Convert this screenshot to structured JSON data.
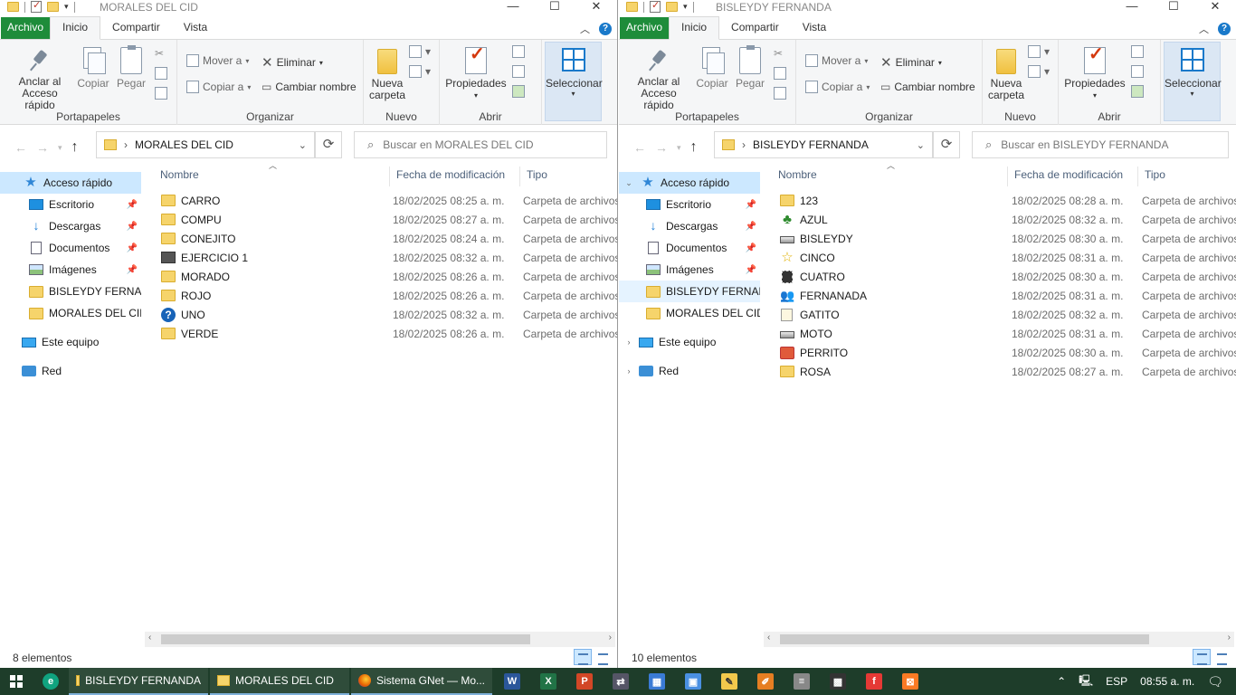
{
  "ribbon_labels": {
    "tab_file": "Archivo",
    "tab_home": "Inicio",
    "tab_share": "Compartir",
    "tab_view": "Vista",
    "pin_quick": "Anclar al",
    "pin_quick2": "Acceso rápido",
    "copy": "Copiar",
    "paste": "Pegar",
    "group_clipboard": "Portapapeles",
    "move_to": "Mover a",
    "copy_to": "Copiar a",
    "delete": "Eliminar",
    "rename": "Cambiar nombre",
    "group_organize": "Organizar",
    "new_folder": "Nueva",
    "new_folder2": "carpeta",
    "group_new": "Nuevo",
    "properties": "Propiedades",
    "group_open": "Abrir",
    "select": "Seleccionar"
  },
  "columns": {
    "name": "Nombre",
    "date": "Fecha de modificación",
    "type": "Tipo"
  },
  "nav": {
    "quick_access": "Acceso rápido",
    "desktop": "Escritorio",
    "downloads": "Descargas",
    "documents": "Documentos",
    "images": "Imágenes",
    "bisleydy": "BISLEYDY FERNANDA",
    "morales": "MORALES DEL CID",
    "this_pc": "Este equipo",
    "network": "Red"
  },
  "left_window": {
    "title": "MORALES DEL CID",
    "address": "MORALES DEL CID",
    "search_placeholder": "Buscar en MORALES DEL CID",
    "status": "8 elementos",
    "files": [
      {
        "name": "CARRO",
        "date": "18/02/2025 08:25 a. m.",
        "type": "Carpeta de archivos",
        "icon": "folder-icon"
      },
      {
        "name": "COMPU",
        "date": "18/02/2025 08:27 a. m.",
        "type": "Carpeta de archivos",
        "icon": "folder-icon"
      },
      {
        "name": "CONEJITO",
        "date": "18/02/2025 08:24 a. m.",
        "type": "Carpeta de archivos",
        "icon": "folder-icon"
      },
      {
        "name": "EJERCICIO 1",
        "date": "18/02/2025 08:32 a. m.",
        "type": "Carpeta de archivos",
        "icon": "program-icon"
      },
      {
        "name": "MORADO",
        "date": "18/02/2025 08:26 a. m.",
        "type": "Carpeta de archivos",
        "icon": "folder-icon"
      },
      {
        "name": "ROJO",
        "date": "18/02/2025 08:26 a. m.",
        "type": "Carpeta de archivos",
        "icon": "folder-icon"
      },
      {
        "name": "UNO",
        "date": "18/02/2025 08:32 a. m.",
        "type": "Carpeta de archivos",
        "icon": "help-icon"
      },
      {
        "name": "VERDE",
        "date": "18/02/2025 08:26 a. m.",
        "type": "Carpeta de archivos",
        "icon": "folder-icon"
      }
    ]
  },
  "right_window": {
    "title": "BISLEYDY FERNANDA",
    "address": "BISLEYDY FERNANDA",
    "search_placeholder": "Buscar en BISLEYDY FERNANDA",
    "status": "10 elementos",
    "files": [
      {
        "name": "123",
        "date": "18/02/2025 08:28 a. m.",
        "type": "Carpeta de archivos",
        "icon": "folder-icon"
      },
      {
        "name": "AZUL",
        "date": "18/02/2025 08:32 a. m.",
        "type": "Carpeta de archivos",
        "icon": "tree-icon"
      },
      {
        "name": "BISLEYDY",
        "date": "18/02/2025 08:30 a. m.",
        "type": "Carpeta de archivos",
        "icon": "drive-icon"
      },
      {
        "name": "CINCO",
        "date": "18/02/2025 08:31 a. m.",
        "type": "Carpeta de archivos",
        "icon": "star-icon"
      },
      {
        "name": "CUATRO",
        "date": "18/02/2025 08:30 a. m.",
        "type": "Carpeta de archivos",
        "icon": "film-icon"
      },
      {
        "name": "FERNANADA",
        "date": "18/02/2025 08:31 a. m.",
        "type": "Carpeta de archivos",
        "icon": "people-icon"
      },
      {
        "name": "GATITO",
        "date": "18/02/2025 08:32 a. m.",
        "type": "Carpeta de archivos",
        "icon": "document-icon"
      },
      {
        "name": "MOTO",
        "date": "18/02/2025 08:31 a. m.",
        "type": "Carpeta de archivos",
        "icon": "drive-icon"
      },
      {
        "name": "PERRITO",
        "date": "18/02/2025 08:30 a. m.",
        "type": "Carpeta de archivos",
        "icon": "red-app-icon"
      },
      {
        "name": "ROSA",
        "date": "18/02/2025 08:27 a. m.",
        "type": "Carpeta de archivos",
        "icon": "folder-icon"
      }
    ]
  },
  "taskbar": {
    "app1": "BISLEYDY FERNANDA",
    "app2": "MORALES DEL CID",
    "app3": "Sistema GNet — Mo...",
    "lang": "ESP",
    "time": "08:55 a. m."
  }
}
